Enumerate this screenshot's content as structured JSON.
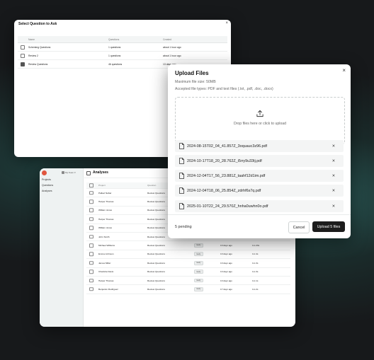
{
  "select_dialog": {
    "title": "Select Question to Ask",
    "close": "×",
    "columns": [
      "Name",
      "Questions",
      "Created"
    ],
    "rows": [
      {
        "name": "Scheming Questions",
        "questions": "1 questions",
        "created": "about 1 hour ago",
        "checked": false
      },
      {
        "name": "Review 2",
        "questions": "1 questions",
        "created": "about 1 hour ago",
        "checked": false
      },
      {
        "name": "Review Questions",
        "questions": "46 questions",
        "created": "13 days ago",
        "checked": true
      }
    ]
  },
  "analyses_window": {
    "team": "My Team",
    "nav": [
      "Projects",
      "Questions",
      "Analyses"
    ],
    "page_title": "Analyses",
    "columns": [
      "Project",
      "Question",
      "",
      "",
      ""
    ],
    "rows": [
      {
        "project": "Pallavi Nahar",
        "question": "Review Questions",
        "status": "",
        "age": "",
        "duration": ""
      },
      {
        "project": "Harper Thomas",
        "question": "Review Questions",
        "status": "",
        "age": "",
        "duration": ""
      },
      {
        "project": "William Jones",
        "question": "Review Questions",
        "status": "",
        "age": "",
        "duration": ""
      },
      {
        "project": "Harper Thomas",
        "question": "Review Questions",
        "status": "",
        "age": "",
        "duration": ""
      },
      {
        "project": "William Jones",
        "question": "Review Questions",
        "status": "",
        "age": "",
        "duration": ""
      },
      {
        "project": "John Smith",
        "question": "Review Questions",
        "status": "",
        "age": "",
        "duration": ""
      },
      {
        "project": "Michael Williams",
        "question": "Review Questions",
        "status": "ready",
        "age": "13 days ago",
        "duration": "1m 23s"
      },
      {
        "project": "Emma Johnson",
        "question": "Review Questions",
        "status": "ready",
        "age": "13 days ago",
        "duration": "1m 4s"
      },
      {
        "project": "James Miller",
        "question": "Review Questions",
        "status": "ready",
        "age": "13 days ago",
        "duration": "1m 3s"
      },
      {
        "project": "Charlotte Davis",
        "question": "Review Questions",
        "status": "ready",
        "age": "13 days ago",
        "duration": "1m 3s"
      },
      {
        "project": "Harper Thomas",
        "question": "Review Questions",
        "status": "ready",
        "age": "13 days ago",
        "duration": "1m 1s"
      },
      {
        "project": "Benjamin Rodriguez",
        "question": "Review Questions",
        "status": "ready",
        "age": "17 days ago",
        "duration": "1m 2s"
      }
    ]
  },
  "upload_dialog": {
    "title": "Upload Files",
    "close": "×",
    "max_size": "Maximum file size: 50MB",
    "accepted": "Accepted file types: PDF and text files (.txt, .pdf, .doc, .docx)",
    "drop_text": "Drop files here or click to upload",
    "files": [
      "2024-08-15T02_04_41.857Z_3oquauc3z96.pdf",
      "2024-10-17T18_20_28.762Z_i5rry9u33tj.pdf",
      "2024-12-04T17_56_23.881Z_taahf12d1im.pdf",
      "2024-12-04T18_06_25.854Z_zdrhf6s7q.pdf",
      "2025-01-10T22_24_29.570Z_hnha0uwhn0o.pdf"
    ],
    "remove": "×",
    "pending": "5 pending",
    "cancel_label": "Cancel",
    "upload_label": "Upload 5 files"
  }
}
